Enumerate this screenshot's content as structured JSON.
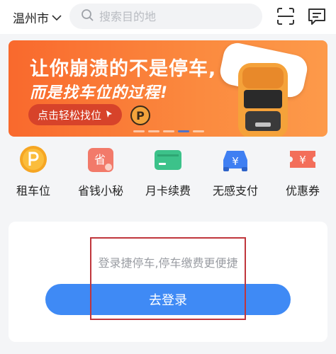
{
  "header": {
    "city": "温州市",
    "search_placeholder": "搜索目的地"
  },
  "banner": {
    "line1": "让你崩溃的不是停车,",
    "line2": "而是找车位的过程!",
    "button_label": "点击轻松找位",
    "badge": "P",
    "active_slide": 4,
    "slide_count": 5
  },
  "quick_entries": [
    {
      "label": "租车位",
      "icon": "parking-coin-icon",
      "color": "#f6a623"
    },
    {
      "label": "省钱小秘",
      "icon": "save-money-icon",
      "color": "#f27a6a"
    },
    {
      "label": "月卡续费",
      "icon": "monthly-card-icon",
      "color": "#3cc28a"
    },
    {
      "label": "无感支付",
      "icon": "car-pay-icon",
      "color": "#3f7ff2"
    },
    {
      "label": "优惠券",
      "icon": "coupon-icon",
      "color": "#f36e5a"
    }
  ],
  "login_card": {
    "tip": "登录捷停车,停车缴费更便捷",
    "button_label": "去登录"
  },
  "colors": {
    "brand_blue": "#3f8af5",
    "banner_orange": "#f9692d",
    "highlight_red": "#c0363c"
  }
}
